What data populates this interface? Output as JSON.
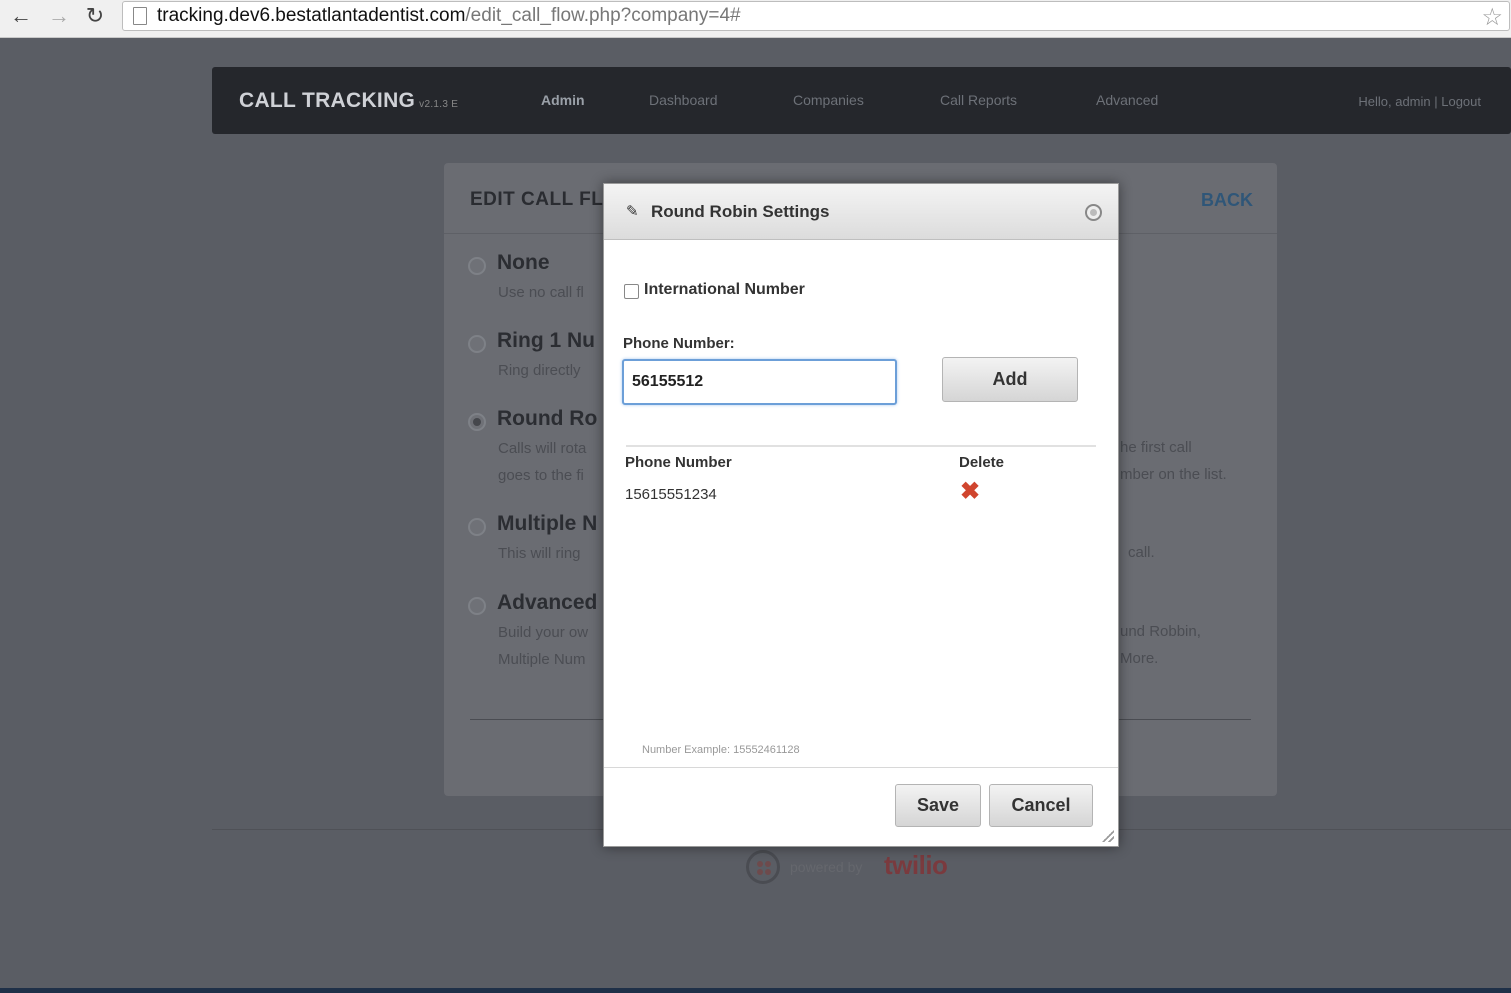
{
  "browser": {
    "url_host": "tracking.dev6.bestatlantadentist.com",
    "url_path": "/edit_call_flow.php?company=4#"
  },
  "nav": {
    "brand": "CALL TRACKING",
    "version": "v2.1.3 E",
    "links": [
      "Admin",
      "Dashboard",
      "Companies",
      "Call Reports",
      "Advanced"
    ],
    "user_links": "Hello, admin | Logout"
  },
  "card": {
    "title": "EDIT CALL FL",
    "back": "BACK",
    "options": [
      {
        "title": "None",
        "desc": "Use no call fl",
        "checked": false
      },
      {
        "title": "Ring 1 Nu",
        "desc": "Ring directly",
        "checked": false
      },
      {
        "title": "Round Ro",
        "desc1": "Calls will rota",
        "desc2": "goes to the fi",
        "right1": "he first call",
        "right2": "mber on the list.",
        "checked": true
      },
      {
        "title": "Multiple N",
        "desc": "This will ring",
        "right1": "call.",
        "checked": false
      },
      {
        "title": "Advanced",
        "desc1": "Build your ow",
        "desc2": "Multiple Num",
        "right1": "und Robbin,",
        "right2": "More.",
        "checked": false
      }
    ]
  },
  "footer": {
    "powered_by": "powered by",
    "twilio": "twilio"
  },
  "modal": {
    "title": "Round Robin Settings",
    "international_label": "International Number",
    "phone_label": "Phone Number:",
    "phone_value": "56155512",
    "add_label": "Add",
    "table_headers": {
      "phone": "Phone Number",
      "delete": "Delete"
    },
    "rows": [
      {
        "phone": "15615551234"
      }
    ],
    "example": "Number Example: 15552461128",
    "save_label": "Save",
    "cancel_label": "Cancel"
  }
}
